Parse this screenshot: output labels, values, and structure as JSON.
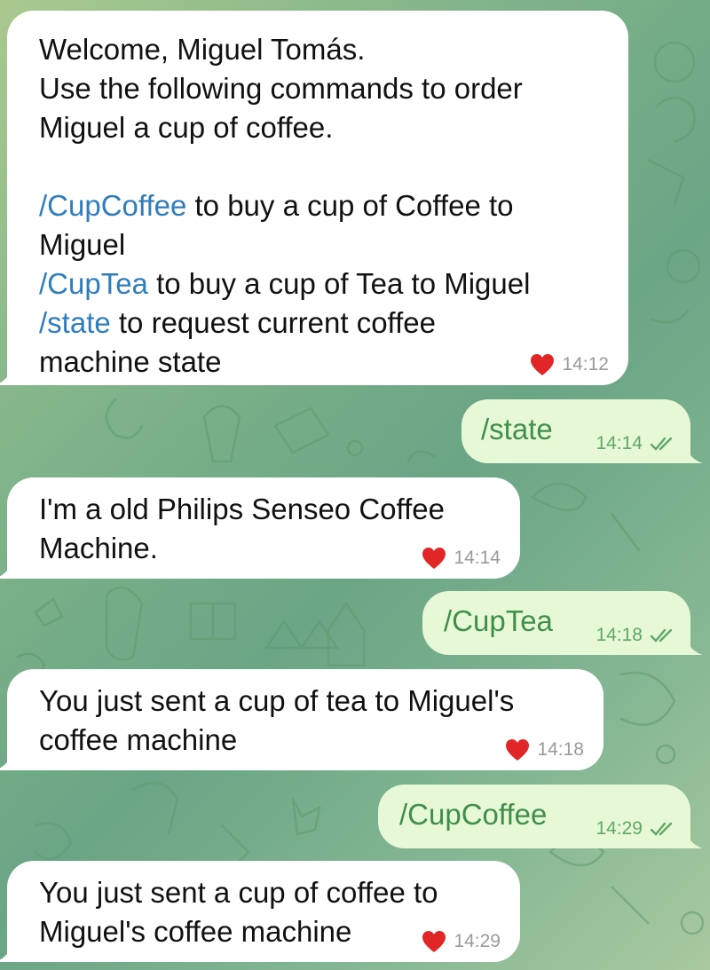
{
  "colors": {
    "incoming_bubble": "#ffffff",
    "outgoing_bubble": "#e7f8d6",
    "command_link": "#2f7dbd",
    "outgoing_text": "#3f8f4a",
    "heart": "#e02626"
  },
  "messages": [
    {
      "direction": "incoming",
      "lines": {
        "l1": "Welcome, Miguel Tomás.",
        "l2": "Use the following commands to order",
        "l3": "Miguel a cup of coffee.",
        "cmd1": "/CupCoffee",
        "cmd1_text": " to buy a cup of Coffee to",
        "cmd1_text2": "Miguel",
        "cmd2": "/CupTea",
        "cmd2_text": " to buy a cup of Tea to Miguel",
        "cmd3": "/state",
        "cmd3_text": " to request current coffee",
        "cmd3_text2": "machine state"
      },
      "time": "14:12",
      "reaction": "heart-icon"
    },
    {
      "direction": "outgoing",
      "text": "/state",
      "time": "14:14",
      "status": "double-check-icon"
    },
    {
      "direction": "incoming",
      "l1": "I'm a old Philips Senseo Coffee",
      "l2": "Machine.",
      "time": "14:14",
      "reaction": "heart-icon"
    },
    {
      "direction": "outgoing",
      "text": "/CupTea",
      "time": "14:18",
      "status": "double-check-icon"
    },
    {
      "direction": "incoming",
      "l1": "You just sent a cup of tea to Miguel's",
      "l2": "coffee machine",
      "time": "14:18",
      "reaction": "heart-icon"
    },
    {
      "direction": "outgoing",
      "text": "/CupCoffee",
      "time": "14:29",
      "status": "double-check-icon"
    },
    {
      "direction": "incoming",
      "l1": "You just sent a cup of coffee to",
      "l2": "Miguel's coffee machine",
      "time": "14:29",
      "reaction": "heart-icon"
    }
  ]
}
